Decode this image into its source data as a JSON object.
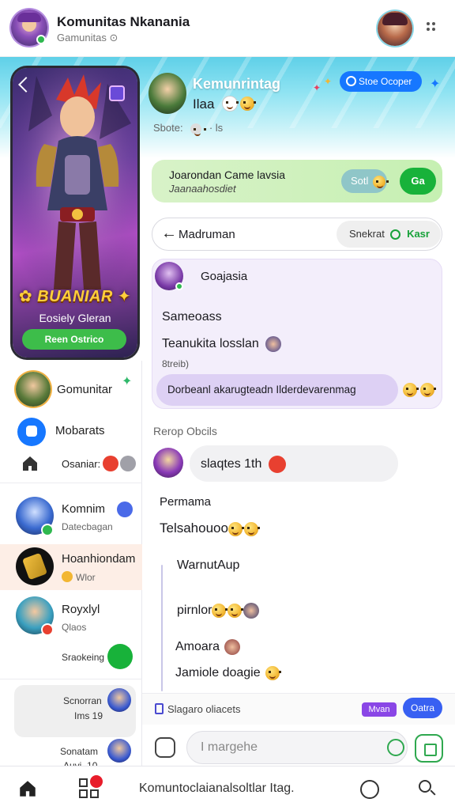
{
  "top_bar": {
    "title": "Komunitas Nkanania",
    "subtitle": "Gamunitas ⊙"
  },
  "hero": {
    "title": "✿ BUANIAR ✦",
    "subtitle": "Eosiely Gleran",
    "button": "Reen Ostrico"
  },
  "left_sidebar": {
    "item1_label": "Gomunitar",
    "item2_label": "Mobarats",
    "item3_label": "Osaniar:",
    "chats": [
      {
        "name": "Komnim",
        "sub": "Datecbagan"
      },
      {
        "name": "Hoanhiondam",
        "sub": "Wlor"
      },
      {
        "name": "Royxlyl",
        "sub": "Qlaos"
      },
      {
        "name": "",
        "sub": "Sraokeing"
      }
    ],
    "card1_line1": "Scnorran",
    "card1_line2": "Ims 19",
    "card2_line1": "Sonatam",
    "card2_line2": "Auvi_10"
  },
  "header": {
    "name": "Kemunrintag",
    "sub": "Ilaa",
    "status": "Sbote:",
    "status_extra": "· ls",
    "follow_button": "Stoe Ocoper"
  },
  "green_card": {
    "title": "Joarondan Came lavsia",
    "sub": "Jaanaahosdiet",
    "pill": "Sotl",
    "action": "Ga"
  },
  "mode_bar": {
    "back_icon": "←",
    "label": "Madruman",
    "pill_text": "Snekrat",
    "pill_accent": "Kasr"
  },
  "message_card": {
    "sender": "Goajasia",
    "line1": "Sameoass",
    "line2": "Teanukita losslan",
    "time": "8treib)",
    "bubble": "Dorbeanl akarugteadn Ilderdevarenmag"
  },
  "reply": {
    "header": "Rerop Obcils",
    "bubble": "slaqtes 1th"
  },
  "thread": {
    "label1": "Permama",
    "label2": "Telsahouoo",
    "label3": "WarnutAup",
    "label4": "pirnlor",
    "label5": "Amoara",
    "label6": "Jamiole doagie"
  },
  "composer": {
    "label": "Slagaro oliacets",
    "tag_purple": "Mvan",
    "tag_blue": "Oatra",
    "placeholder": "I margehe"
  },
  "bottom_nav": {
    "text": "Komuntoclaianalsoltlar Itag."
  },
  "colors": {
    "accent_blue": "#1677ff",
    "accent_green": "#18b23a",
    "accent_purple": "#8a46e6",
    "bubble_purple": "#ddd0f4"
  }
}
